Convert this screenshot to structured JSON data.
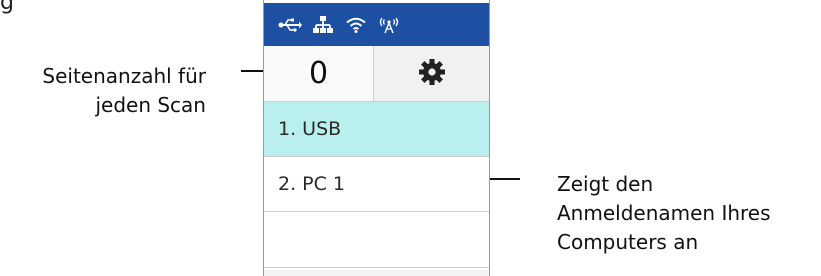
{
  "cropped_top_text": "g",
  "callouts": {
    "left": [
      "Seitenanzahl für",
      "jeden Scan"
    ],
    "right": [
      "Zeigt den",
      "Anmeldenamen Ihres",
      "Computers an"
    ]
  },
  "status_icons": [
    "usb-icon",
    "ethernet-icon",
    "wifi-icon",
    "wireless-ap-icon"
  ],
  "colors": {
    "status_bar": "#1d4fa3",
    "selected_row": "#b9f0ee",
    "divider": "#cfcfcf"
  },
  "counter": {
    "value": "0"
  },
  "settings": {
    "icon": "gear-icon"
  },
  "destinations": [
    {
      "label": "1. USB",
      "selected": true
    },
    {
      "label": "2. PC 1",
      "selected": false
    },
    {
      "label": "",
      "selected": false
    }
  ]
}
